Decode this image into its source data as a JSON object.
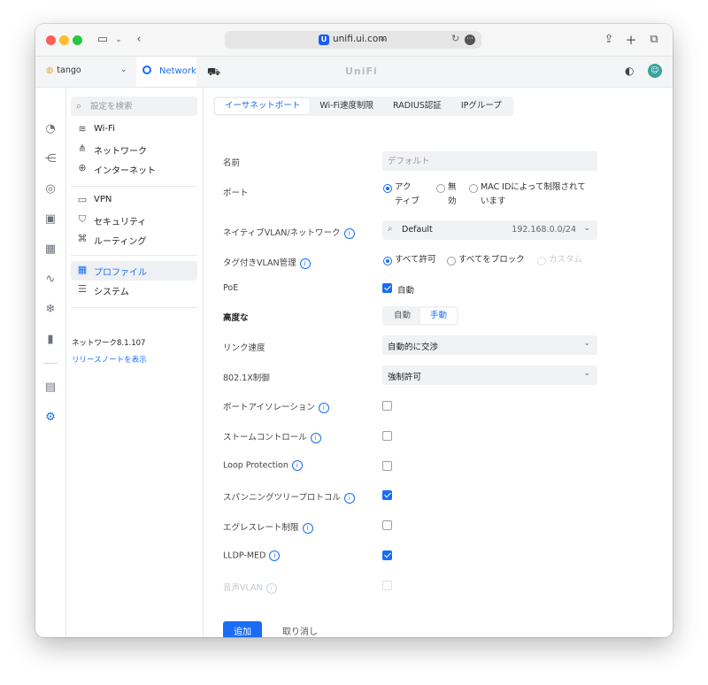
{
  "browser": {
    "url": "unifi.ui.com",
    "site_logo": "U"
  },
  "header": {
    "site_name": "tango",
    "app_tab": "Network",
    "brand": "UniFi"
  },
  "sidebar": {
    "search_placeholder": "設定を検索",
    "items": [
      {
        "label": "Wi-Fi",
        "icon": "wifi-icon"
      },
      {
        "label": "ネットワーク",
        "icon": "network-tree-icon"
      },
      {
        "label": "インターネット",
        "icon": "globe-icon"
      },
      {
        "label": "VPN",
        "icon": "vpn-icon"
      },
      {
        "label": "セキュリティ",
        "icon": "shield-icon"
      },
      {
        "label": "ルーティング",
        "icon": "routing-icon"
      },
      {
        "label": "プロファイル",
        "icon": "profiles-icon",
        "active": true
      },
      {
        "label": "システム",
        "icon": "system-icon"
      }
    ],
    "version": "ネットワーク8.1.107",
    "release_notes": "リリースノートを表示"
  },
  "tabs": [
    "イーサネットポート",
    "Wi-Fi速度制限",
    "RADIUS認証",
    "IPグループ"
  ],
  "form": {
    "name_label": "名前",
    "name_placeholder": "デフォルト",
    "port_label": "ポート",
    "port_options": [
      "アク\nティブ",
      "無\n効",
      "MAC IDによって制限されて\nいます"
    ],
    "native_vlan_label": "ネイティブVLAN/ネットワーク",
    "native_vlan_value": "Default",
    "native_vlan_subnet": "192.168.0.0/24",
    "tagged_vlan_label": "タグ付きVLAN管理",
    "tagged_vlan_options": [
      "すべて許可",
      "すべてをブロック",
      "カスタム"
    ],
    "poe_label": "PoE",
    "poe_value": "自動",
    "advanced_label": "高度な",
    "advanced_options": [
      "自動",
      "手動"
    ],
    "link_speed_label": "リンク速度",
    "link_speed_value": "自動的に交渉",
    "dot1x_label": "802.1X制御",
    "dot1x_value": "強制許可",
    "port_isolation_label": "ポートアイソレーション",
    "storm_control_label": "ストームコントロール",
    "loop_protection_label": "Loop Protection",
    "stp_label": "スパンニングツリープロトコル",
    "egress_label": "エグレスレート制限",
    "lldp_label": "LLDP-MED",
    "voice_vlan_label": "音声VLAN"
  },
  "actions": {
    "add": "追加",
    "cancel": "取り消し"
  },
  "colors": {
    "accent": "#1a6cf4"
  }
}
